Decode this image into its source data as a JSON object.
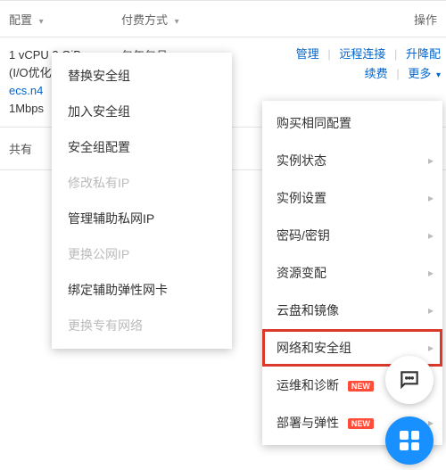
{
  "header": {
    "spec": "配置",
    "pay": "付费方式",
    "ops": "操作"
  },
  "instance": {
    "spec_line1": "1 vCPU 2 GiB",
    "spec_line2": "(I/O优化)",
    "spec_type": "ecs.n4",
    "spec_bw": "1Mbps",
    "pay": "包年包月"
  },
  "ops": {
    "manage": "管理",
    "remote": "远程连接",
    "resize": "升降配",
    "renew": "续费",
    "more": "更多"
  },
  "share": {
    "label": "共有"
  },
  "submenu": [
    "替换安全组",
    "加入安全组",
    "安全组配置",
    "修改私有IP",
    "管理辅助私网IP",
    "更换公网IP",
    "绑定辅助弹性网卡",
    "更换专有网络"
  ],
  "dropdown": [
    {
      "label": "购买相同配置"
    },
    {
      "label": "实例状态"
    },
    {
      "label": "实例设置"
    },
    {
      "label": "密码/密钥"
    },
    {
      "label": "资源变配"
    },
    {
      "label": "云盘和镜像"
    },
    {
      "label": "网络和安全组"
    },
    {
      "label": "运维和诊断"
    },
    {
      "label": "部署与弹性"
    }
  ],
  "badges": {
    "new": "NEW"
  }
}
